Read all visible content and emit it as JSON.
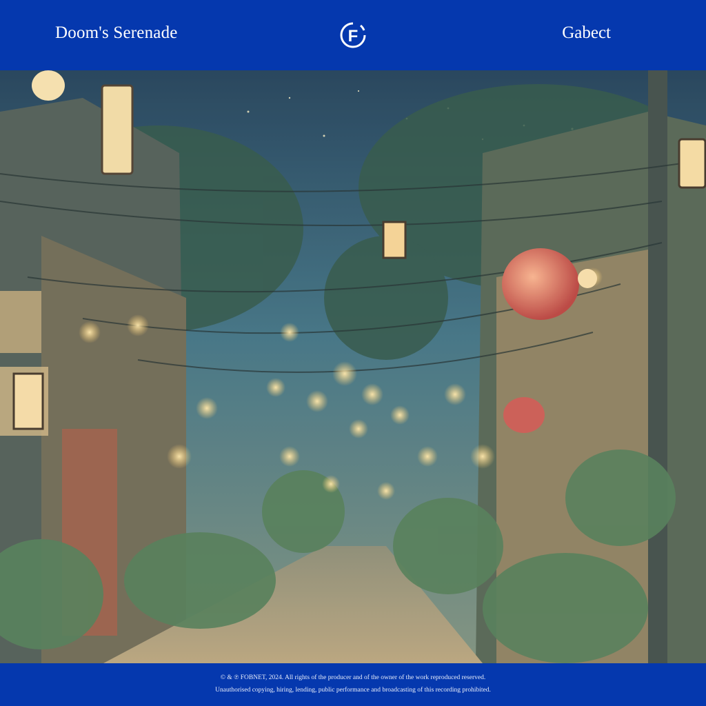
{
  "header": {
    "title": "Doom's Serenade",
    "artist": "Gabect",
    "logo_icon": "fobnet-f-logo-icon",
    "logo_letter": "F"
  },
  "artwork": {
    "description_icon": "lantern-street-illustration"
  },
  "footer": {
    "line1": "© & ℗ FOBNET, 2024. All rights of the producer and of the owner of the work reproduced reserved.",
    "line2": "Unauthorised copying, hiring, lending, public performance and broadcasting of this recording prohibited."
  },
  "colors": {
    "brand_blue": "#0538ae",
    "text": "#ffffff"
  }
}
